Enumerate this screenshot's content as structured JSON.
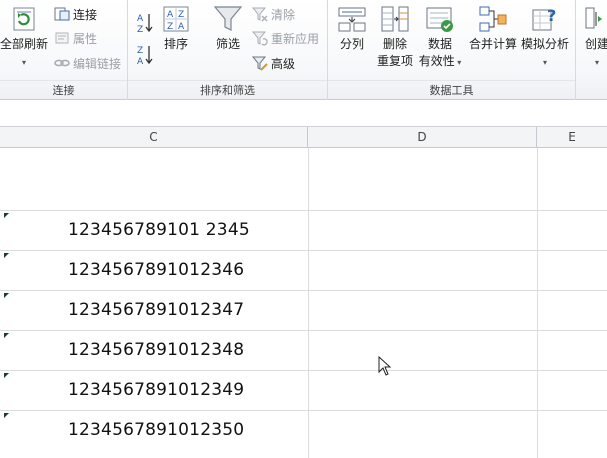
{
  "ribbon": {
    "connections": {
      "refresh_all_label": "全部刷新",
      "connections_label": "连接",
      "properties_label": "属性",
      "edit_links_label": "编辑链接",
      "group_label": "连接"
    },
    "sort_filter": {
      "sort_label": "排序",
      "filter_label": "筛选",
      "clear_label": "清除",
      "reapply_label": "重新应用",
      "advanced_label": "高级",
      "group_label": "排序和筛选"
    },
    "data_tools": {
      "text_to_columns_label": "分列",
      "remove_duplicates_label_1": "删除",
      "remove_duplicates_label_2": "重复项",
      "validation_label_1": "数据",
      "validation_label_2": "有效性",
      "consolidate_label": "合并计算",
      "whatif_label": "模拟分析",
      "group_label": "数据工具"
    },
    "outline": {
      "create_label": "创建"
    }
  },
  "columns": [
    "C",
    "D",
    "E"
  ],
  "cells": [
    "123456789101 2345",
    "1234567891012346",
    "1234567891012347",
    "1234567891012348",
    "1234567891012349",
    "1234567891012350"
  ]
}
